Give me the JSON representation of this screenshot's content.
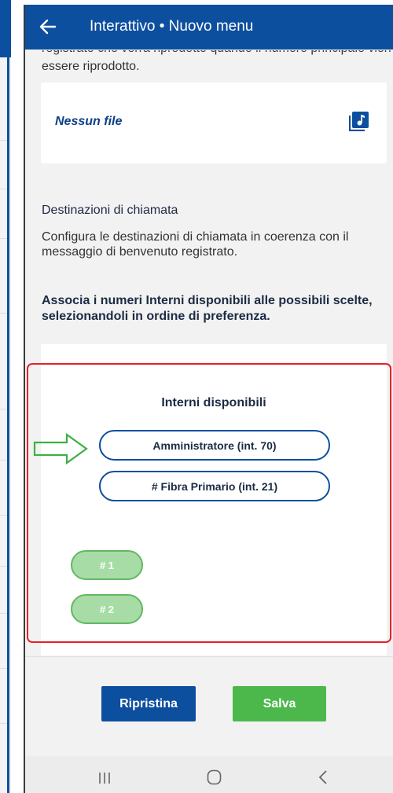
{
  "app_bar": {
    "title": "Interattivo • Nuovo menu"
  },
  "intro": {
    "tail": "essere riprodotto."
  },
  "file": {
    "label": "Nessun file"
  },
  "destinations": {
    "title": "Destinazioni di chiamata",
    "description": "Configura le destinazioni di chiamata in coerenza con il messaggio di benvenuto registrato.",
    "assoc_text": "Associa i numeri Interni disponibili alle possibili scelte, selezionandoli in ordine di preferenza."
  },
  "extensions": {
    "title": "Interni disponibili",
    "items": [
      {
        "label": "Amministratore (int. 70)"
      },
      {
        "label": "# Fibra Primario (int. 21)"
      }
    ],
    "slots": [
      {
        "label": "# 1"
      },
      {
        "label": "# 2"
      }
    ]
  },
  "actions": {
    "reset_label": "Ripristina",
    "save_label": "Salva"
  },
  "colors": {
    "brand_blue": "#0d4f9f",
    "save_green": "#4cb84c",
    "slot_green": "#a8dca6",
    "annotation_red": "#e3232b",
    "annotation_arrow_green": "#3cb043"
  },
  "icons": {
    "back": "arrow-left-icon",
    "file": "music-file-icon",
    "nav_recent": "recent-apps-icon",
    "nav_home": "home-icon",
    "nav_back": "chevron-left-icon",
    "annotation": "outline-arrow-right-icon"
  }
}
